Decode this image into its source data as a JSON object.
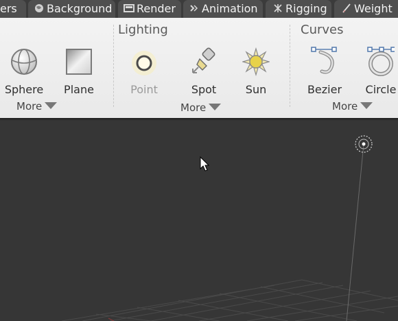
{
  "tabs": [
    {
      "label": "ers",
      "icon": "layers-icon"
    },
    {
      "label": "Background",
      "icon": "globe-icon"
    },
    {
      "label": "Render",
      "icon": "render-icon"
    },
    {
      "label": "Animation",
      "icon": "animation-icon"
    },
    {
      "label": "Rigging",
      "icon": "rigging-icon"
    },
    {
      "label": "Weight",
      "icon": "weight-icon"
    }
  ],
  "groups": {
    "primitives": {
      "title": "",
      "tools": [
        {
          "label": "Sphere",
          "icon": "sphere-icon"
        },
        {
          "label": "Plane",
          "icon": "plane-icon"
        }
      ],
      "more_label": "More"
    },
    "lighting": {
      "title": "Lighting",
      "tools": [
        {
          "label": "Point",
          "icon": "point-light-icon",
          "state": "disabled"
        },
        {
          "label": "Spot",
          "icon": "spot-light-icon"
        },
        {
          "label": "Sun",
          "icon": "sun-icon"
        }
      ],
      "more_label": "More"
    },
    "curves": {
      "title": "Curves",
      "tools": [
        {
          "label": "Bezier",
          "icon": "bezier-curve-icon"
        },
        {
          "label": "Circle",
          "icon": "circle-curve-icon"
        }
      ],
      "more_label": "More"
    }
  },
  "viewport": {
    "background": "#363636",
    "objects": [
      "light-gizmo",
      "floor-grid",
      "mouse-cursor"
    ]
  }
}
